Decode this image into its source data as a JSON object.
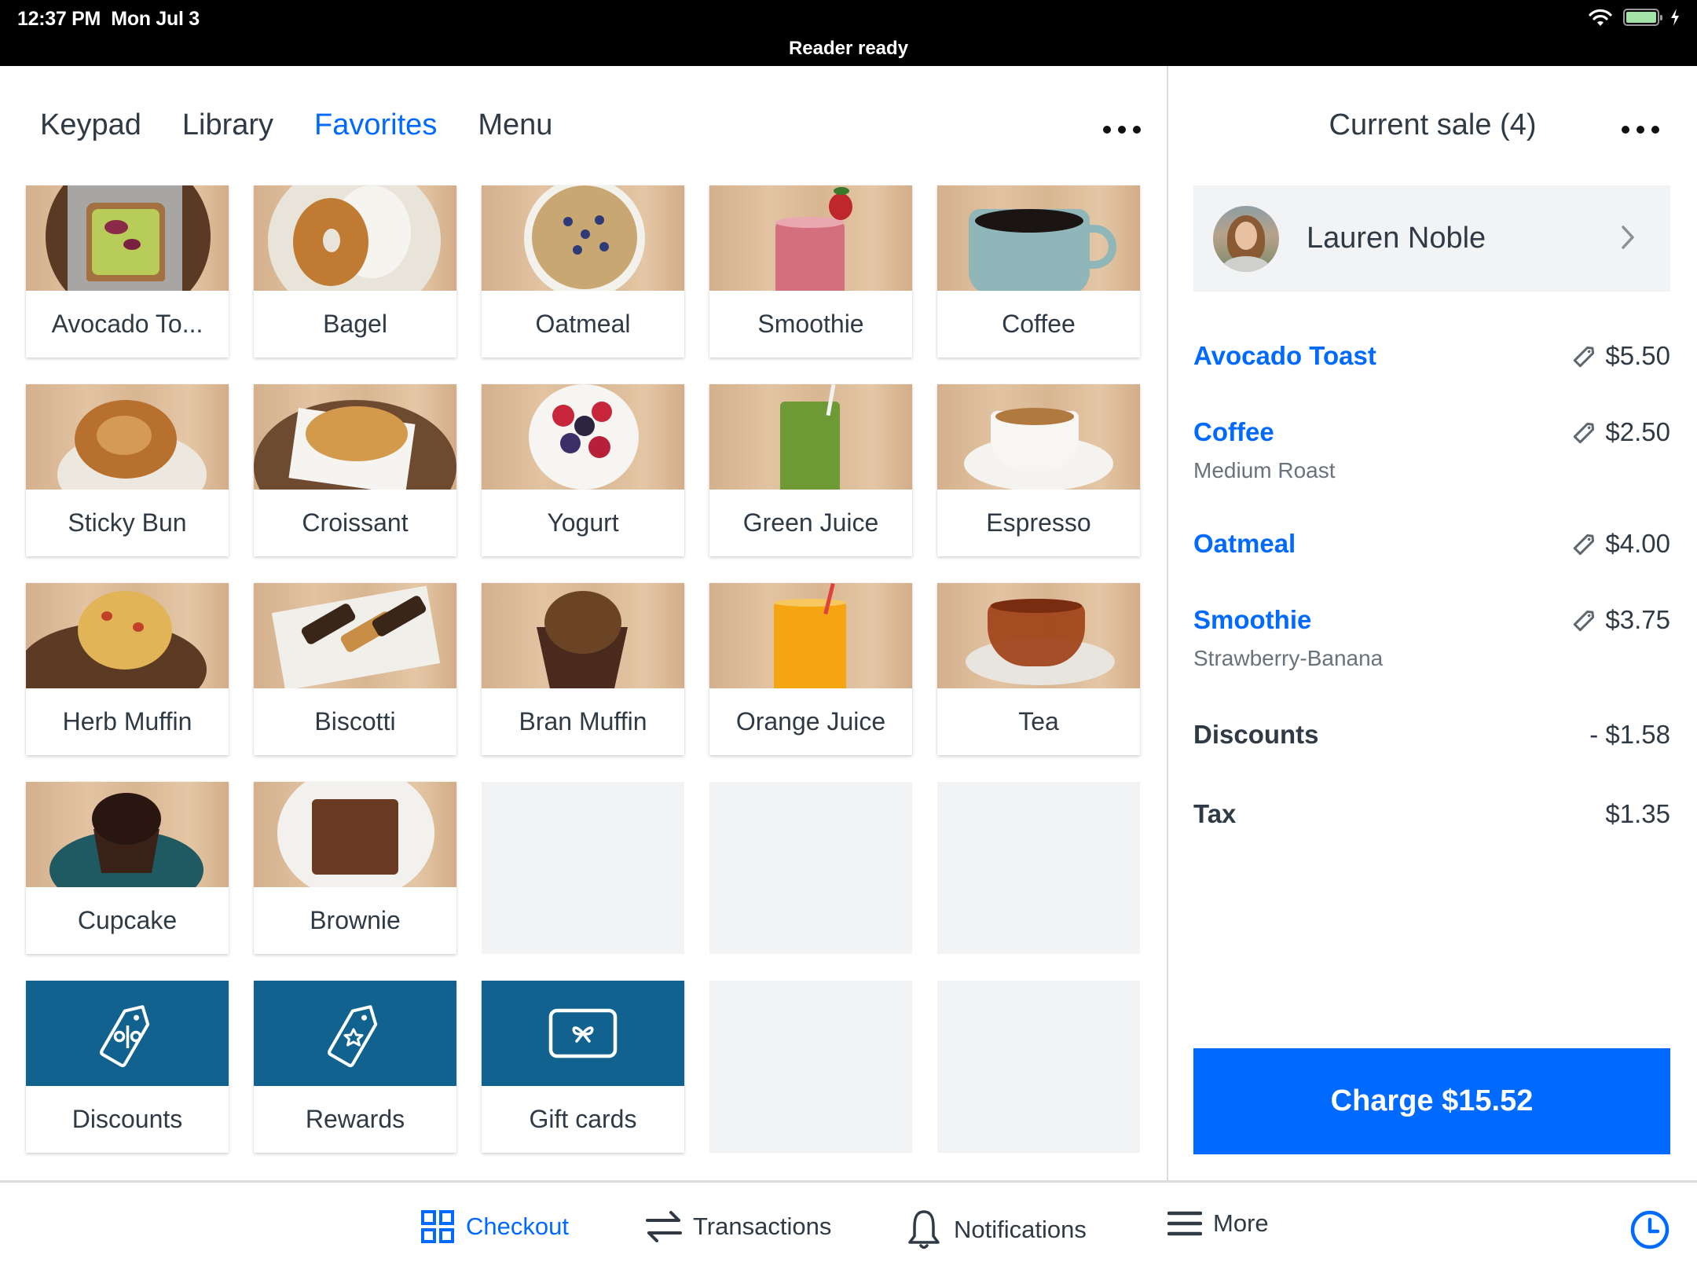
{
  "status_bar": {
    "time": "12:37 PM",
    "date": "Mon Jul 3",
    "reader_status": "Reader ready",
    "icons": [
      "wifi-icon",
      "battery-icon",
      "charging-bolt-icon"
    ],
    "battery_level": 1.0
  },
  "tabs": [
    {
      "label": "Keypad",
      "active": false
    },
    {
      "label": "Library",
      "active": false
    },
    {
      "label": "Favorites",
      "active": true
    },
    {
      "label": "Menu",
      "active": false
    }
  ],
  "favorites": [
    {
      "label": "Avocado To...",
      "full_name": "Avocado Toast",
      "type": "item"
    },
    {
      "label": "Bagel",
      "type": "item"
    },
    {
      "label": "Oatmeal",
      "type": "item"
    },
    {
      "label": "Smoothie",
      "type": "item"
    },
    {
      "label": "Coffee",
      "type": "item"
    },
    {
      "label": "Sticky Bun",
      "type": "item"
    },
    {
      "label": "Croissant",
      "type": "item"
    },
    {
      "label": "Yogurt",
      "type": "item"
    },
    {
      "label": "Green Juice",
      "type": "item"
    },
    {
      "label": "Espresso",
      "type": "item"
    },
    {
      "label": "Herb Muffin",
      "type": "item"
    },
    {
      "label": "Biscotti",
      "type": "item"
    },
    {
      "label": "Bran Muffin",
      "type": "item"
    },
    {
      "label": "Orange Juice",
      "type": "item"
    },
    {
      "label": "Tea",
      "type": "item"
    },
    {
      "label": "Cupcake",
      "type": "item"
    },
    {
      "label": "Brownie",
      "type": "item"
    },
    {
      "label": "",
      "type": "empty"
    },
    {
      "label": "",
      "type": "empty"
    },
    {
      "label": "",
      "type": "empty"
    },
    {
      "label": "Discounts",
      "type": "action",
      "icon": "discount-tag-icon"
    },
    {
      "label": "Rewards",
      "type": "action",
      "icon": "reward-tag-icon"
    },
    {
      "label": "Gift cards",
      "type": "action",
      "icon": "gift-card-icon"
    },
    {
      "label": "",
      "type": "empty"
    },
    {
      "label": "",
      "type": "empty"
    }
  ],
  "sale": {
    "title": "Current sale (4)",
    "customer": {
      "name": "Lauren Noble"
    },
    "items": [
      {
        "name": "Avocado Toast",
        "variant": "",
        "price": "$5.50"
      },
      {
        "name": "Coffee",
        "variant": "Medium Roast",
        "price": "$2.50"
      },
      {
        "name": "Oatmeal",
        "variant": "",
        "price": "$4.00"
      },
      {
        "name": "Smoothie",
        "variant": "Strawberry-Banana",
        "price": "$3.75"
      }
    ],
    "discounts": {
      "label": "Discounts",
      "value": "- $1.58"
    },
    "tax": {
      "label": "Tax",
      "value": "$1.35"
    },
    "charge_label": "Charge $15.52"
  },
  "bottom_nav": [
    {
      "label": "Checkout",
      "icon": "grid-icon",
      "active": true
    },
    {
      "label": "Transactions",
      "icon": "transfer-arrows-icon",
      "active": false
    },
    {
      "label": "Notifications",
      "icon": "bell-icon",
      "active": false
    },
    {
      "label": "More",
      "icon": "menu-icon",
      "active": false
    }
  ],
  "colors": {
    "accent": "#006aff",
    "action_tile": "#12628f",
    "text": "#2f3a44",
    "muted": "#6a737b",
    "empty_tile": "#f2f3f5"
  }
}
